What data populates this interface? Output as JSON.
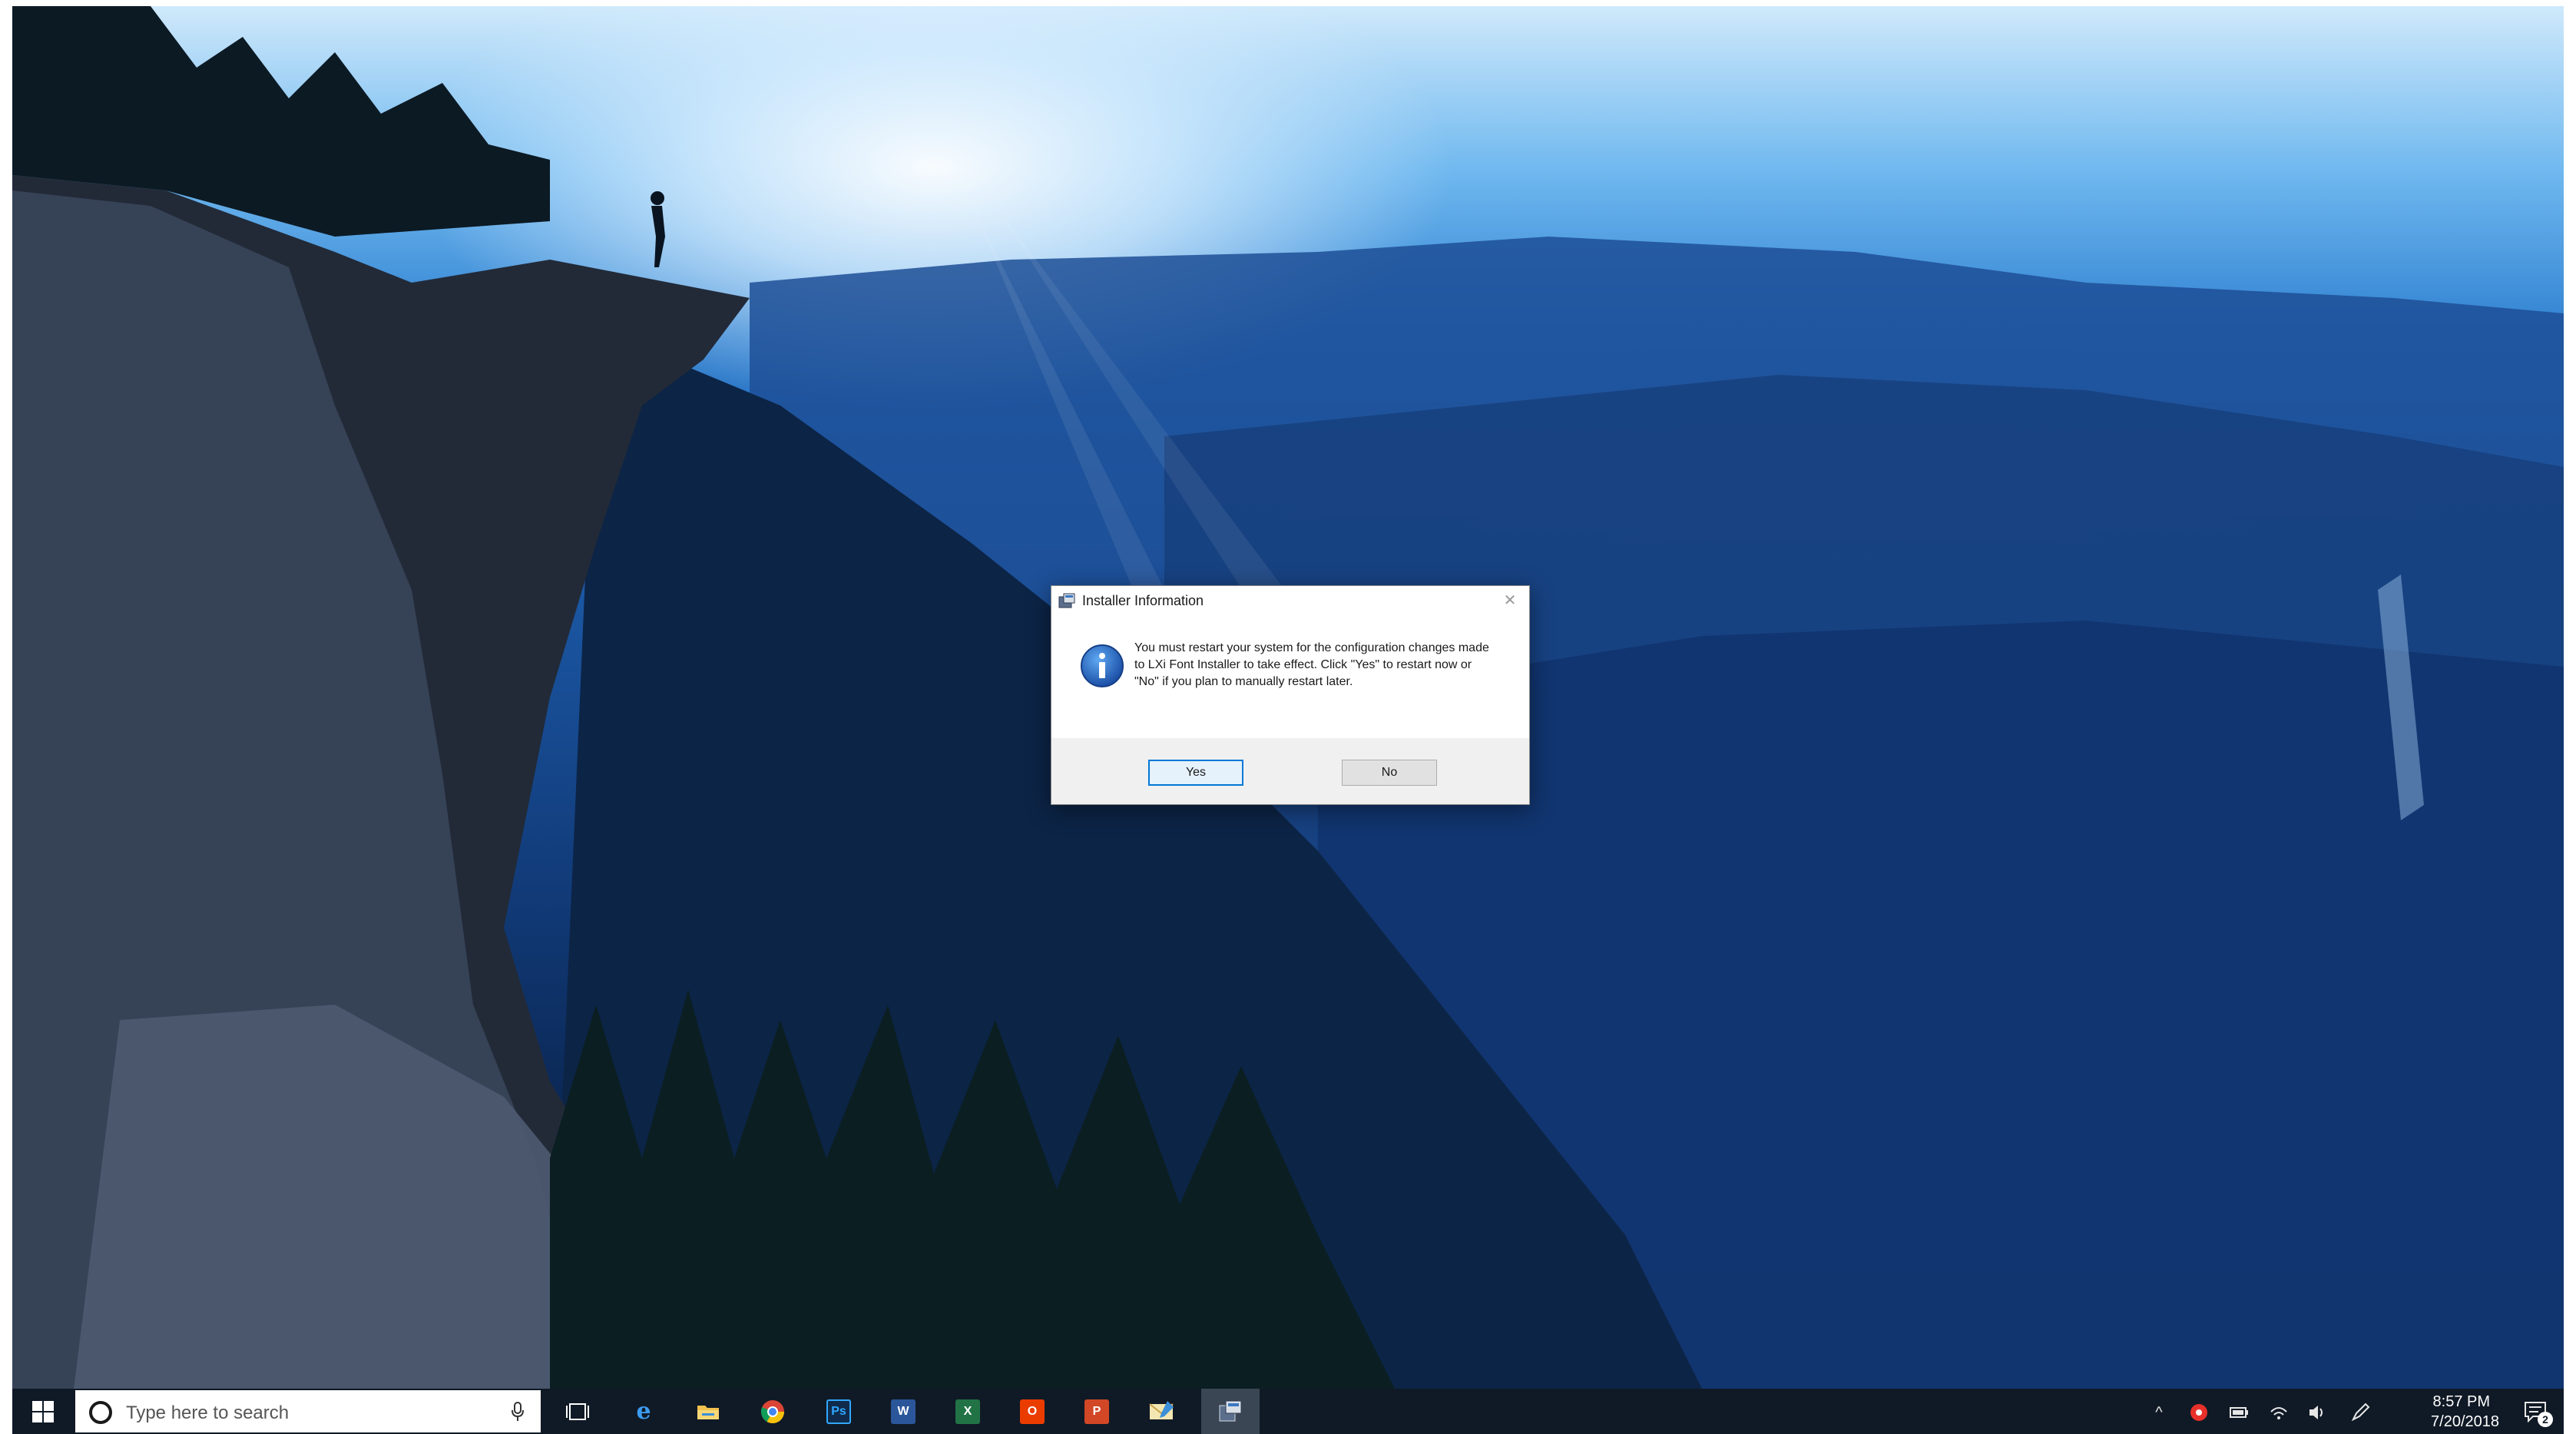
{
  "dialog": {
    "title": "Installer Information",
    "message": "You must restart your system for the configuration changes made to LXi Font Installer to take effect. Click \"Yes\" to restart now or \"No\" if you plan to manually restart later.",
    "yes_label": "Yes",
    "no_label": "No"
  },
  "taskbar": {
    "search_placeholder": "Type here to search",
    "apps": [
      {
        "name": "task-view-icon"
      },
      {
        "name": "edge-icon"
      },
      {
        "name": "file-explorer-icon"
      },
      {
        "name": "chrome-icon"
      },
      {
        "name": "photoshop-icon",
        "label": "Ps"
      },
      {
        "name": "word-icon",
        "label": "W"
      },
      {
        "name": "excel-icon",
        "label": "X"
      },
      {
        "name": "office-icon",
        "label": "O"
      },
      {
        "name": "powerpoint-icon",
        "label": "P"
      },
      {
        "name": "mail-icon"
      },
      {
        "name": "installer-icon"
      }
    ]
  },
  "tray": {
    "time": "8:57 PM",
    "date": "7/20/2018",
    "notification_count": "2"
  },
  "colors": {
    "taskbar": "#101a26",
    "accent": "#0078d7",
    "dialog_footer": "#f0f0f0"
  }
}
